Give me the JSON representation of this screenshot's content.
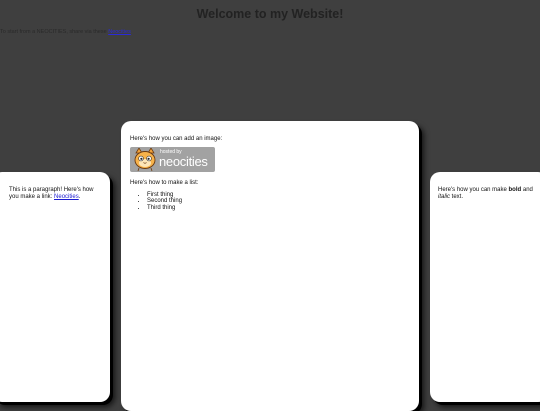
{
  "header": {
    "title": "Welcome to my Website!",
    "intro_text": "To start from a NEOCITIES, share via these",
    "intro_link": "Neocities"
  },
  "left_panel": {
    "text_before_link": "This is a paragraph! Here's how you make a link: ",
    "link_text": "Neocities",
    "text_after_link": "."
  },
  "center_panel": {
    "image_caption": "Here's how you can add an image:",
    "badge": {
      "hosted_by": "hosted by",
      "brand": "neocities",
      "icon": "neocities-cat-icon"
    },
    "list_caption": "Here's how to make a list:",
    "list_items": [
      "First thing",
      "Second thing",
      "Third thing"
    ]
  },
  "right_panel": {
    "text_before_bold": "Here's how you can make ",
    "bold_text": "bold",
    "text_between": " and ",
    "italic_text": "italic",
    "text_after": " text."
  },
  "colors": {
    "background": "#3f3f3f",
    "panel": "#ffffff",
    "link": "#1a1ad0",
    "badge": "#a2a2a2"
  }
}
